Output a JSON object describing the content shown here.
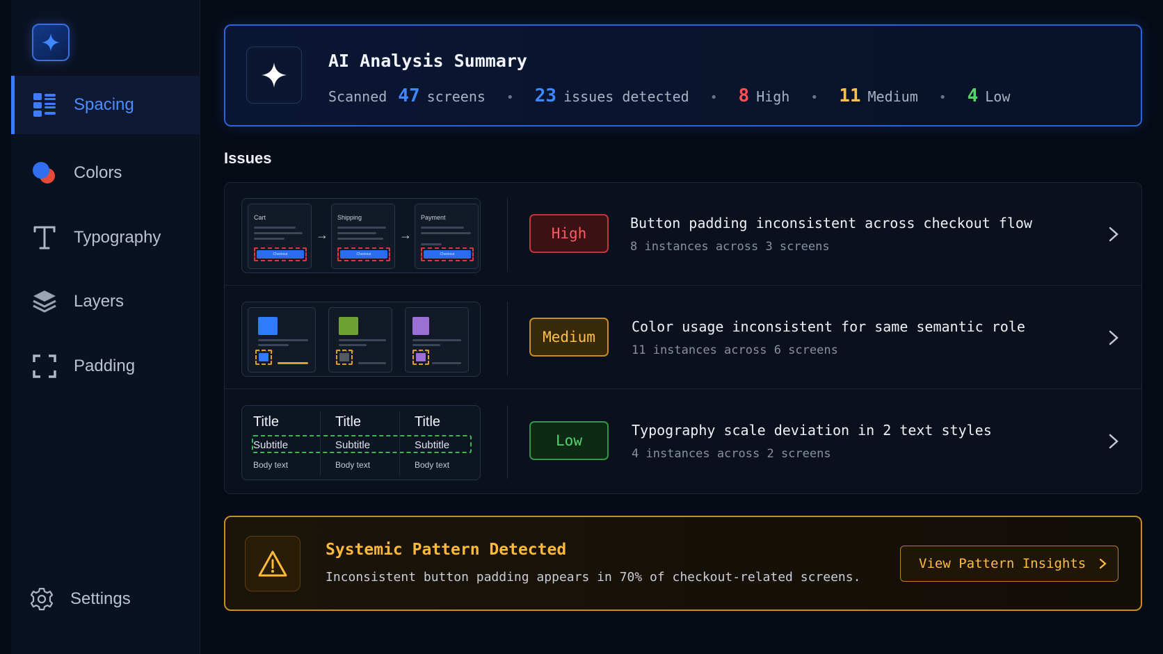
{
  "sidebar": {
    "items": [
      {
        "label": "Spacing",
        "icon": "spacing-grid-icon",
        "active": true
      },
      {
        "label": "Colors",
        "icon": "colors-icon",
        "active": false
      },
      {
        "label": "Typography",
        "icon": "typography-icon",
        "active": false
      },
      {
        "label": "Layers",
        "icon": "layers-icon",
        "active": false
      },
      {
        "label": "Padding",
        "icon": "padding-icon",
        "active": false
      }
    ],
    "settings_label": "Settings"
  },
  "summary": {
    "title": "AI Analysis Summary",
    "scanned_prefix": "Scanned",
    "screens_count": "47",
    "screens_label": "screens",
    "issues_count": "23",
    "issues_label": "issues detected",
    "high_count": "8",
    "high_label": "High",
    "medium_count": "11",
    "medium_label": "Medium",
    "low_count": "4",
    "low_label": "Low",
    "dot": "•"
  },
  "issues_heading": "Issues",
  "issues": [
    {
      "severity": "High",
      "title": "Button padding inconsistent across checkout flow",
      "subtitle": "8 instances across 3 screens",
      "thumb_labels": [
        "Cart",
        "Shipping",
        "Payment"
      ],
      "thumb_button_text": [
        "Checkout",
        "Checkout",
        "Checkout"
      ],
      "arrow": "→"
    },
    {
      "severity": "Medium",
      "title": "Color usage inconsistent for same semantic role",
      "subtitle": "11 instances across 6 screens",
      "swatch_colors": [
        "#2f7bff",
        "#6fa235",
        "#9b6fd6"
      ]
    },
    {
      "severity": "Low",
      "title": "Typography scale deviation in 2 text styles",
      "subtitle": "4 instances across 2 screens",
      "thumb_title": "Title",
      "thumb_subtitle": "Subtitle",
      "thumb_body": "Body text"
    }
  ],
  "pattern": {
    "title": "Systemic Pattern Detected",
    "description": "Inconsistent button padding appears in 70% of checkout-related screens.",
    "button_label": "View Pattern Insights"
  },
  "colors": {
    "accent": "#3d7bff",
    "high": "#ff5a5f",
    "medium": "#ffc047",
    "low": "#55d36b",
    "warning": "#ffb938"
  }
}
